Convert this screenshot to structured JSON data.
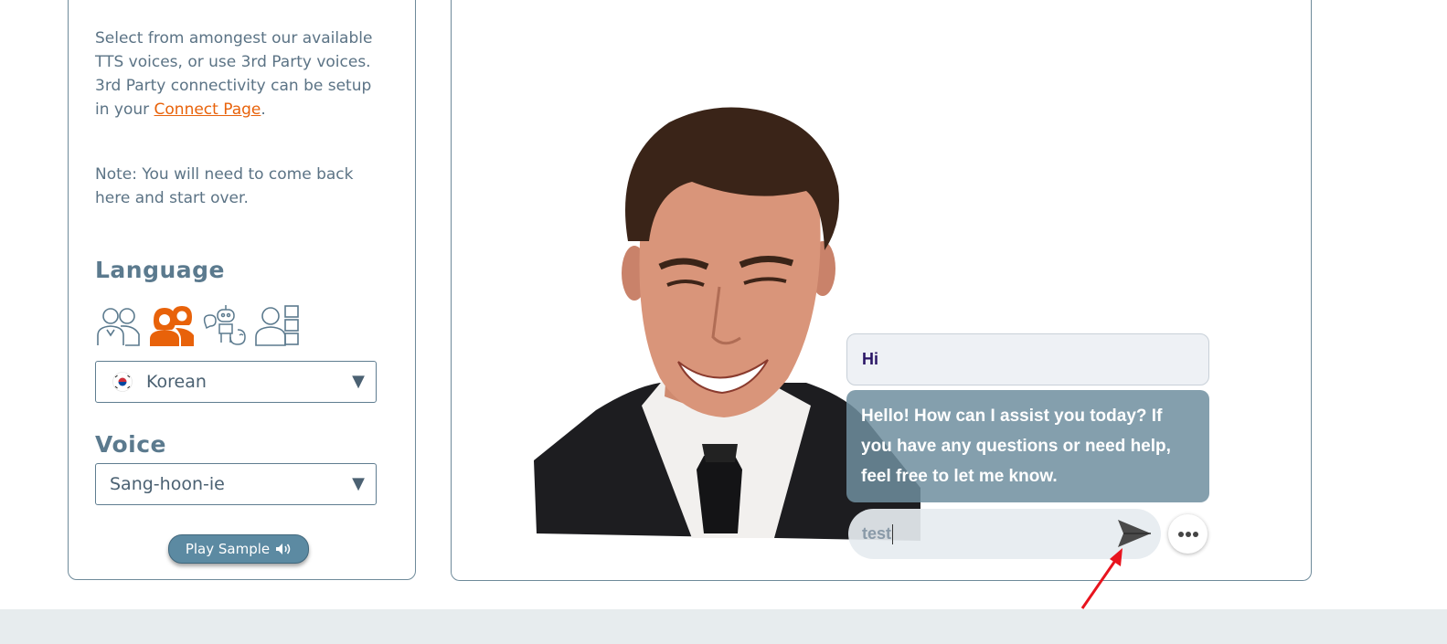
{
  "left_panel": {
    "description_prefix": "Select from amongest our available TTS voices, or use 3rd Party voices. 3rd Party connectivity can be setup in your ",
    "connect_link": "Connect Page",
    "description_suffix": ".",
    "note": "Note: You will need to come back here and start over.",
    "language_title": "Language",
    "language_icons": [
      "group-icon",
      "female-voices-icon",
      "robot-voices-icon",
      "custom-voices-icon"
    ],
    "selected_language_icon": "female-voices-icon",
    "language_value": "Korean",
    "voice_title": "Voice",
    "voice_value": "Sang-hoon-ie",
    "play_sample_label": "Play Sample"
  },
  "chat": {
    "user_message": "Hi",
    "bot_message": "Hello! How can I assist you today? If you have any questions or need help, feel free to let me know.",
    "input_value": "test"
  },
  "colors": {
    "accent": "#e8620a",
    "text": "#5b7385",
    "panel_border": "#6e8a9a",
    "bot_bubble": "#6e8e9f",
    "footer": "#e7ecee"
  }
}
